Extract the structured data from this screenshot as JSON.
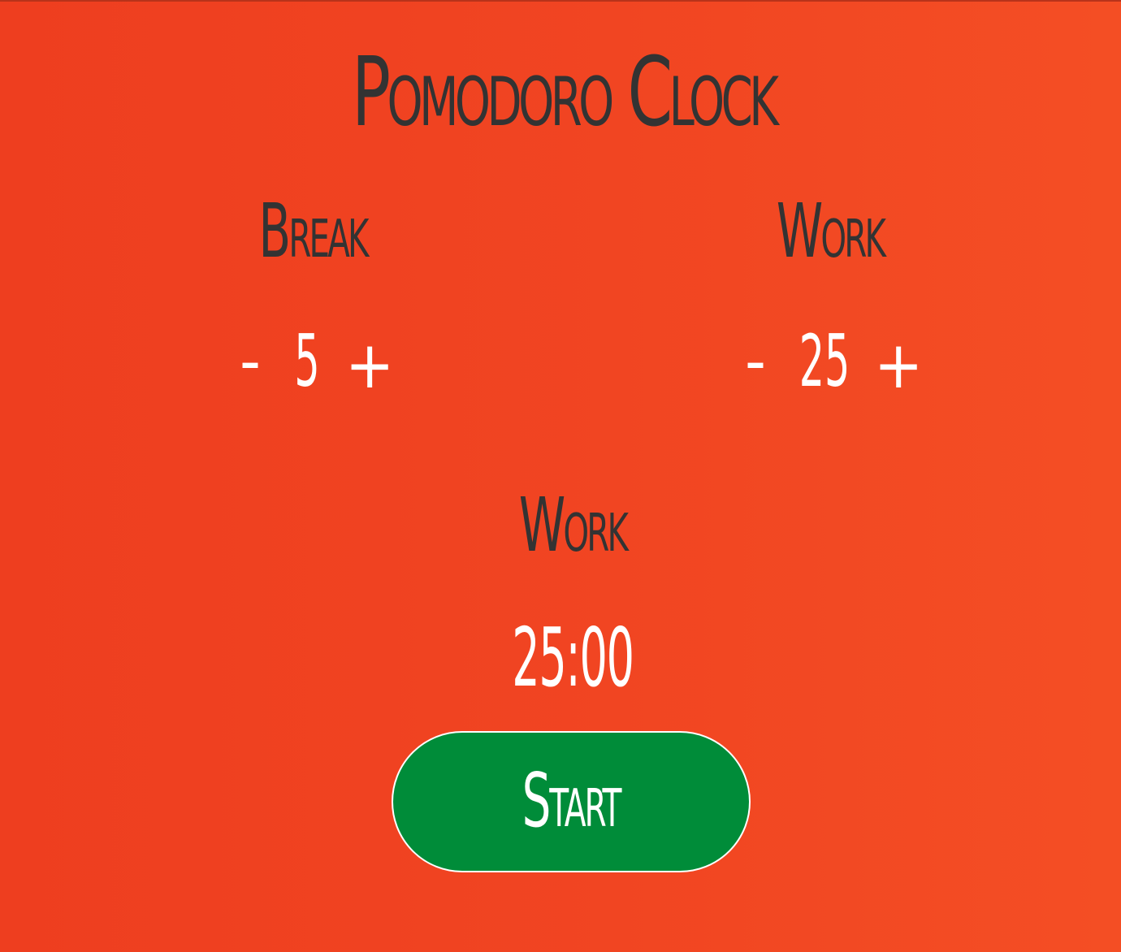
{
  "app": {
    "title": "Pomodoro Clock"
  },
  "break": {
    "label": "Break",
    "decrement_label": "-",
    "value": "5",
    "increment_label": "+"
  },
  "work": {
    "label": "Work",
    "decrement_label": "-",
    "value": "25",
    "increment_label": "+"
  },
  "session": {
    "label": "Work",
    "time": "25:00"
  },
  "controls": {
    "start_label": "Start"
  },
  "colors": {
    "background": "#f14522",
    "text_dark": "#333333",
    "text_light": "#ffffff",
    "button": "#008c39"
  }
}
